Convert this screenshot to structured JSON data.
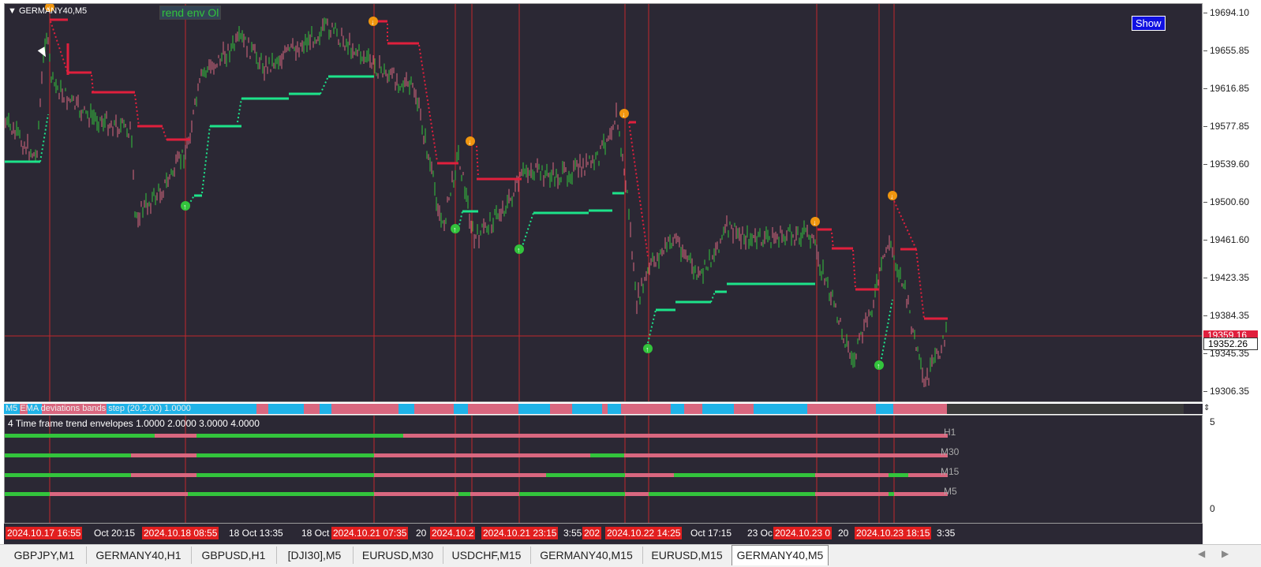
{
  "chart": {
    "symbol_label": "GERMANY40,M5",
    "indicator_tag": "rend env Ol",
    "show_button": "Show",
    "price_ticks": [
      "19694.10",
      "19655.85",
      "19616.85",
      "19577.85",
      "19539.60",
      "19500.60",
      "19461.60",
      "19423.35",
      "19384.35",
      "19345.35",
      "19306.35"
    ],
    "current_price_red": "19359.16",
    "current_price": "19352.26",
    "strip_label": "M5 EMA deviations bands step (20,2.00) 1.0000",
    "subwindow_title": "4 Time frame trend envelopes 1.0000 2.0000 3.0000 4.0000",
    "sub_axis_top": "5",
    "sub_axis_bottom": "0",
    "tf_labels": [
      "H1",
      "M30",
      "M15",
      "M5"
    ],
    "time_labels": [
      {
        "text": "2024.10.17 16:55",
        "red": true
      },
      {
        "text": "Oct 20:15",
        "red": false
      },
      {
        "text": "2024.10.18 08:55",
        "red": true
      },
      {
        "text": "18 Oct 13:35",
        "red": false
      },
      {
        "text": "18 Oct",
        "red": false
      },
      {
        "text": "2024.10.21 07:35",
        "red": true
      },
      {
        "text": "20",
        "red": false
      },
      {
        "text": "2024.10.2",
        "red": true
      },
      {
        "text": "2024.10.21 23:15",
        "red": true
      },
      {
        "text": "3:55",
        "red": false
      },
      {
        "text": "202",
        "red": true
      },
      {
        "text": "2024.10.22 14:25",
        "red": true
      },
      {
        "text": "Oct 17:15",
        "red": false
      },
      {
        "text": "23 Oc",
        "red": false
      },
      {
        "text": "2024.10.23 0",
        "red": true
      },
      {
        "text": "20",
        "red": false
      },
      {
        "text": "2024.10.23 18:15",
        "red": true
      },
      {
        "text": "3:35",
        "red": false
      }
    ]
  },
  "tabs": [
    "GBPJPY,M1",
    "GERMANY40,H1",
    "GBPUSD,H1",
    "[DJI30],M5",
    "EURUSD,M30",
    "USDCHF,M15",
    "GERMANY40,M15",
    "EURUSD,M15",
    "GERMANY40,M5"
  ],
  "active_tab": "GERMANY40,M5",
  "colors": {
    "bg": "#2b2834",
    "bull": "#33c43c",
    "bear": "#d9677f",
    "red": "#e01f3d",
    "green": "#1de38a",
    "cyan": "#1fb3e8",
    "signal": "#f0960f"
  }
}
